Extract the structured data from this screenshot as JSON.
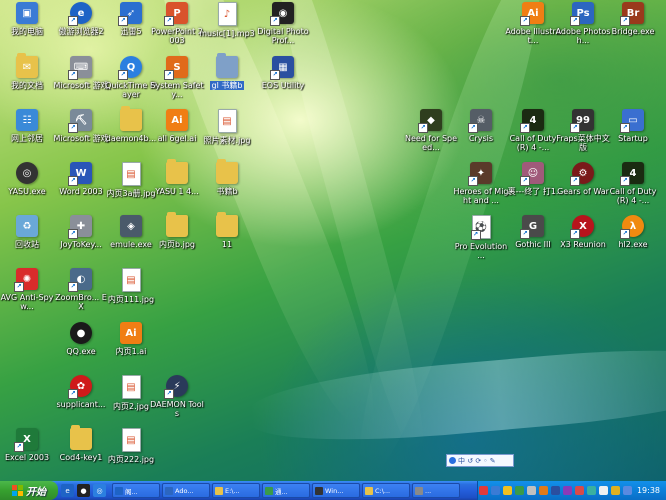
{
  "desktop": {
    "icons": [
      {
        "name": "icon-my-computer",
        "label": "我的电脑",
        "glyph": "▣",
        "color": "#3a7bd5",
        "kind": "box",
        "sc": false
      },
      {
        "name": "icon-browser2",
        "label": "傲游浏览器2",
        "glyph": "e",
        "color": "#1e63c6",
        "kind": "round",
        "sc": true
      },
      {
        "name": "icon-thunder5",
        "label": "迅雷5",
        "glyph": "➶",
        "color": "#2b6fd0",
        "kind": "box",
        "sc": true
      },
      {
        "name": "icon-powerpoint",
        "label": "PowerPoint 2003",
        "glyph": "P",
        "color": "#d9532c",
        "kind": "box",
        "sc": true
      },
      {
        "name": "icon-music-mp3",
        "label": "music[1].mp3",
        "glyph": "♪",
        "color": "#ffffff",
        "kind": "doc",
        "sc": false
      },
      {
        "name": "icon-digital-photo",
        "label": "Digital Photo Prof...",
        "glyph": "◉",
        "color": "#222222",
        "kind": "box",
        "sc": true
      },
      {
        "name": "icon-illustrator",
        "label": "Adobe Illustrat...",
        "glyph": "Ai",
        "color": "#f07e14",
        "kind": "box",
        "sc": true
      },
      {
        "name": "icon-photoshop",
        "label": "Adobe Photosh...",
        "glyph": "Ps",
        "color": "#2c66c0",
        "kind": "box",
        "sc": true
      },
      {
        "name": "icon-bridge",
        "label": "Bridge.exe",
        "glyph": "Br",
        "color": "#9a3a1c",
        "kind": "box",
        "sc": true
      },
      {
        "name": "icon-my-documents",
        "label": "我的文档",
        "glyph": "✉",
        "color": "#e8c24a",
        "kind": "folder",
        "sc": false
      },
      {
        "name": "icon-ms-word-1",
        "label": "Microsoft 游戏",
        "glyph": "⌨",
        "color": "#8a8f99",
        "kind": "box",
        "sc": true
      },
      {
        "name": "icon-quicktime",
        "label": "QuickTime Player",
        "glyph": "Q",
        "color": "#2b7fe0",
        "kind": "round",
        "sc": true
      },
      {
        "name": "icon-system-safety",
        "label": "System Safety...",
        "glyph": "S",
        "color": "#e06a1a",
        "kind": "box",
        "sc": true
      },
      {
        "name": "icon-folder-selected",
        "label": "gl 书籍b",
        "glyph": "",
        "color": "#7fa0c8",
        "kind": "folder",
        "sc": false
      },
      {
        "name": "icon-eos-utility",
        "label": "EOS Utility",
        "glyph": "▦",
        "color": "#2a4fa0",
        "kind": "box",
        "sc": true
      },
      {
        "name": "icon-network",
        "label": "网上邻居",
        "glyph": "☷",
        "color": "#3a8ad8",
        "kind": "box",
        "sc": false
      },
      {
        "name": "icon-ms-game",
        "label": "Microsoft 游戏",
        "glyph": "⛏",
        "color": "#7a8a99",
        "kind": "box",
        "sc": true
      },
      {
        "name": "icon-daemon4",
        "label": "daemon4b...",
        "glyph": "",
        "color": "#e8c24a",
        "kind": "folder",
        "sc": false
      },
      {
        "name": "icon-ai-file",
        "label": "all 6gel.ai",
        "glyph": "Ai",
        "color": "#f07e14",
        "kind": "box",
        "sc": false
      },
      {
        "name": "icon-jpg-photo",
        "label": "照片素材.jpg",
        "glyph": "▤",
        "color": "#ffffff",
        "kind": "doc",
        "sc": false
      },
      {
        "name": "icon-nfs",
        "label": "Need for Speed...",
        "glyph": "◆",
        "color": "#2f3e1e",
        "kind": "box",
        "sc": true
      },
      {
        "name": "icon-crysis",
        "label": "Crysis",
        "glyph": "☠",
        "color": "#555d66",
        "kind": "box",
        "sc": true
      },
      {
        "name": "icon-cod4-a",
        "label": "Call of Duty(R) 4 -...",
        "glyph": "4",
        "color": "#1b2b12",
        "kind": "box",
        "sc": true
      },
      {
        "name": "icon-fraps",
        "label": "Fraps菜体中文版",
        "glyph": "99",
        "color": "#333333",
        "kind": "box",
        "sc": true
      },
      {
        "name": "icon-startup",
        "label": "Startup",
        "glyph": "▭",
        "color": "#3a6fd0",
        "kind": "box",
        "sc": true
      },
      {
        "name": "icon-yasu-exe",
        "label": "YASU.exe",
        "glyph": "◎",
        "color": "#333333",
        "kind": "round",
        "sc": false
      },
      {
        "name": "icon-word-2003",
        "label": "Word 2003",
        "glyph": "W",
        "color": "#2a56b8",
        "kind": "box",
        "sc": true
      },
      {
        "name": "icon-neiye3-jpg",
        "label": "内页3a册.jpg",
        "glyph": "▤",
        "color": "#ffffff",
        "kind": "doc",
        "sc": false
      },
      {
        "name": "icon-yasu-folder",
        "label": "YASU 1 4...",
        "glyph": "",
        "color": "#e8c24a",
        "kind": "folder",
        "sc": false
      },
      {
        "name": "icon-books-folder",
        "label": "书籍b",
        "glyph": "",
        "color": "#e8c24a",
        "kind": "folder",
        "sc": false
      },
      {
        "name": "icon-heroes",
        "label": "Heroes of Might and ...",
        "glyph": "✦",
        "color": "#5a3a2a",
        "kind": "box",
        "sc": true
      },
      {
        "name": "icon-game-anime",
        "label": "裹---终了 打1.",
        "glyph": "☺",
        "color": "#a05a7a",
        "kind": "box",
        "sc": true
      },
      {
        "name": "icon-gears-of-war",
        "label": "Gears of War",
        "glyph": "⚙",
        "color": "#7a1a1a",
        "kind": "round",
        "sc": true
      },
      {
        "name": "icon-cod4-b",
        "label": "Call of Duty(R) 4 -...",
        "glyph": "4",
        "color": "#1b2b12",
        "kind": "box",
        "sc": true
      },
      {
        "name": "icon-recycle-bin",
        "label": "回收站",
        "glyph": "♻",
        "color": "#6aa8d8",
        "kind": "box",
        "sc": false
      },
      {
        "name": "icon-joytokey",
        "label": "JoyToKey...",
        "glyph": "✚",
        "color": "#8a8f99",
        "kind": "box",
        "sc": true
      },
      {
        "name": "icon-emule",
        "label": "emule.exe",
        "glyph": "◈",
        "color": "#4a5a6a",
        "kind": "box",
        "sc": false
      },
      {
        "name": "icon-neiye-b-jpg",
        "label": "内页b.jpg",
        "glyph": "",
        "color": "#e8c24a",
        "kind": "folder",
        "sc": false
      },
      {
        "name": "icon-folder-11",
        "label": "11",
        "glyph": "",
        "color": "#e8c24a",
        "kind": "folder",
        "sc": false
      },
      {
        "name": "icon-pes",
        "label": "Pro Evolution ...",
        "glyph": "⚽",
        "color": "#ffffff",
        "kind": "doc",
        "sc": true
      },
      {
        "name": "icon-gothic3",
        "label": "Gothic III",
        "glyph": "G",
        "color": "#4a4a4a",
        "kind": "box",
        "sc": true
      },
      {
        "name": "icon-x3-reunion",
        "label": "X3 Reunion",
        "glyph": "X",
        "color": "#b8141c",
        "kind": "round",
        "sc": true
      },
      {
        "name": "icon-hl2",
        "label": "hl2.exe",
        "glyph": "λ",
        "color": "#f08a10",
        "kind": "round",
        "sc": true
      },
      {
        "name": "icon-avg",
        "label": "AVG Anti-Spyw...",
        "glyph": "✺",
        "color": "#d92b2b",
        "kind": "box",
        "sc": true
      },
      {
        "name": "icon-zoombrowser",
        "label": "ZoomBro... EX",
        "glyph": "◐",
        "color": "#4a6a8a",
        "kind": "box",
        "sc": true
      },
      {
        "name": "icon-neiye111-jpg",
        "label": "内页111.jpg",
        "glyph": "▤",
        "color": "#ffffff",
        "kind": "doc",
        "sc": false
      },
      {
        "name": "icon-qq",
        "label": "QQ.exe",
        "glyph": "●",
        "color": "#1a1a1a",
        "kind": "round",
        "sc": false
      },
      {
        "name": "icon-neiye1-ai",
        "label": "内页1.ai",
        "glyph": "Ai",
        "color": "#f07e14",
        "kind": "box",
        "sc": false
      },
      {
        "name": "icon-supplicant",
        "label": "supplicant...",
        "glyph": "✿",
        "color": "#cf1a1a",
        "kind": "round",
        "sc": true
      },
      {
        "name": "icon-neiye2-jpg",
        "label": "内页2.jpg",
        "glyph": "▤",
        "color": "#ffffff",
        "kind": "doc",
        "sc": false
      },
      {
        "name": "icon-daemon-tools",
        "label": "DAEMON Tools",
        "glyph": "⚡",
        "color": "#2a3a5a",
        "kind": "round",
        "sc": true
      },
      {
        "name": "icon-excel-2003",
        "label": "Excel 2003",
        "glyph": "X",
        "color": "#1f7a3a",
        "kind": "box",
        "sc": true
      },
      {
        "name": "icon-cod4-key",
        "label": "Cod4-key1",
        "glyph": "",
        "color": "#e8c24a",
        "kind": "folder",
        "sc": false
      },
      {
        "name": "icon-neiye222-jpg",
        "label": "内页222.jpg",
        "glyph": "▤",
        "color": "#ffffff",
        "kind": "doc",
        "sc": false
      }
    ]
  },
  "ime_bar": {
    "text": "中 ↺ ⟳ ◦ ✎"
  },
  "taskbar": {
    "start_label": "开始",
    "quick_launch": [
      {
        "name": "ql-ie-icon",
        "glyph": "e",
        "color": "#1e63c6"
      },
      {
        "name": "ql-qq-icon",
        "glyph": "●",
        "color": "#222"
      },
      {
        "name": "ql-browser-icon",
        "glyph": "◎",
        "color": "#2b7fe0"
      }
    ],
    "tasks": [
      {
        "name": "task-browser",
        "label": "阁...",
        "color": "#1e63c6"
      },
      {
        "name": "task-photoshop",
        "label": "Ado...",
        "color": "#2c66c0"
      },
      {
        "name": "task-explorer",
        "label": "E:\\...",
        "color": "#e8c24a"
      },
      {
        "name": "task-image",
        "label": "通...",
        "color": "#3a9a4a"
      },
      {
        "name": "task-winamp",
        "label": "Win...",
        "color": "#333"
      },
      {
        "name": "task-folder",
        "label": "C:\\...",
        "color": "#e8c24a"
      },
      {
        "name": "task-app",
        "label": "...",
        "color": "#8a8a8a"
      }
    ],
    "tray_icon_colors": [
      "#e03a3a",
      "#3a7bd5",
      "#f0c020",
      "#3a9a4a",
      "#c0c0c0",
      "#e07a1a",
      "#2a4fa0",
      "#8a3ab8",
      "#d94a4a",
      "#3ab0a0",
      "#f0f0f0",
      "#e0b020",
      "#5a8ae0"
    ],
    "clock": "19:38"
  }
}
